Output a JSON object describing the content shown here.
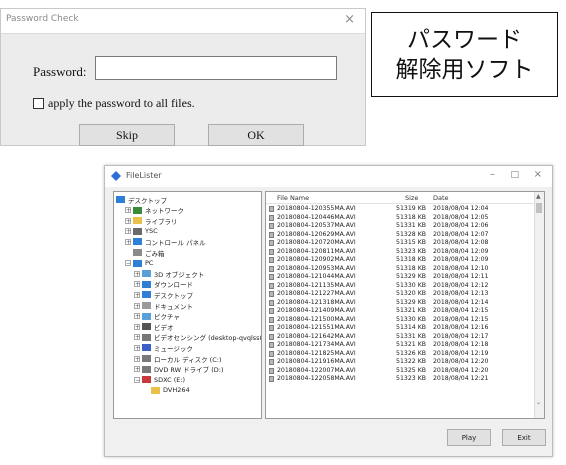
{
  "password_dialog": {
    "title": "Password Check",
    "close_glyph": "×",
    "password_label": "Password:",
    "password_value": "",
    "apply_all_label": "apply the password to all files.",
    "apply_all_checked": false,
    "skip_label": "Skip",
    "ok_label": "OK"
  },
  "caption": {
    "line1": "パスワード",
    "line2": "解除用ソフト"
  },
  "filelister": {
    "title": "FileLister",
    "window_controls": {
      "minimize": "–",
      "maximize": "□",
      "close": "×"
    },
    "tree": [
      {
        "label": "デスクトップ",
        "icon": "desktop-icon",
        "expander": "",
        "depth": 0
      },
      {
        "label": "ネットワーク",
        "icon": "network-icon",
        "expander": "+",
        "depth": 1
      },
      {
        "label": "ライブラリ",
        "icon": "library-icon",
        "expander": "+",
        "depth": 1
      },
      {
        "label": "YSC",
        "icon": "user-icon",
        "expander": "+",
        "depth": 1
      },
      {
        "label": "コントロール パネル",
        "icon": "control-panel-icon",
        "expander": "+",
        "depth": 1
      },
      {
        "label": "ごみ箱",
        "icon": "recycle-bin-icon",
        "expander": "",
        "depth": 1
      },
      {
        "label": "PC",
        "icon": "pc-icon",
        "expander": "−",
        "depth": 1
      },
      {
        "label": "3D オブジェクト",
        "icon": "folder-3d-icon",
        "expander": "+",
        "depth": 2
      },
      {
        "label": "ダウンロード",
        "icon": "download-icon",
        "expander": "+",
        "depth": 2
      },
      {
        "label": "デスクトップ",
        "icon": "desktop-icon",
        "expander": "+",
        "depth": 2
      },
      {
        "label": "ドキュメント",
        "icon": "documents-icon",
        "expander": "+",
        "depth": 2
      },
      {
        "label": "ピクチャ",
        "icon": "pictures-icon",
        "expander": "+",
        "depth": 2
      },
      {
        "label": "ビデオ",
        "icon": "video-icon",
        "expander": "+",
        "depth": 2
      },
      {
        "label": "ビデオセンシング (desktop-qvqlss8q)",
        "icon": "network-drive-icon",
        "expander": "+",
        "depth": 2
      },
      {
        "label": "ミュージック",
        "icon": "music-icon",
        "expander": "+",
        "depth": 2
      },
      {
        "label": "ローカル ディスク (C:)",
        "icon": "disk-icon",
        "expander": "+",
        "depth": 2
      },
      {
        "label": "DVD RW ドライブ (D:)",
        "icon": "dvd-drive-icon",
        "expander": "+",
        "depth": 2
      },
      {
        "label": "SDXC (E:)",
        "icon": "sd-card-icon",
        "expander": "−",
        "depth": 2
      },
      {
        "label": "DVH264",
        "icon": "folder-icon",
        "expander": "",
        "depth": 3
      }
    ],
    "columns": {
      "name": "File Name",
      "size": "Size",
      "date": "Date"
    },
    "files": [
      {
        "name": "20180804-120355MA.AVI",
        "size": "51319 KB",
        "date": "2018/08/04 12:04"
      },
      {
        "name": "20180804-120446MA.AVI",
        "size": "51318 KB",
        "date": "2018/08/04 12:05"
      },
      {
        "name": "20180804-120537MA.AVI",
        "size": "51331 KB",
        "date": "2018/08/04 12:06"
      },
      {
        "name": "20180804-120629MA.AVI",
        "size": "51328 KB",
        "date": "2018/08/04 12:07"
      },
      {
        "name": "20180804-120720MA.AVI",
        "size": "51315 KB",
        "date": "2018/08/04 12:08"
      },
      {
        "name": "20180804-120811MA.AVI",
        "size": "51323 KB",
        "date": "2018/08/04 12:09"
      },
      {
        "name": "20180804-120902MA.AVI",
        "size": "51318 KB",
        "date": "2018/08/04 12:09"
      },
      {
        "name": "20180804-120953MA.AVI",
        "size": "51318 KB",
        "date": "2018/08/04 12:10"
      },
      {
        "name": "20180804-121044MA.AVI",
        "size": "51329 KB",
        "date": "2018/08/04 12:11"
      },
      {
        "name": "20180804-121135MA.AVI",
        "size": "51330 KB",
        "date": "2018/08/04 12:12"
      },
      {
        "name": "20180804-121227MA.AVI",
        "size": "51320 KB",
        "date": "2018/08/04 12:13"
      },
      {
        "name": "20180804-121318MA.AVI",
        "size": "51329 KB",
        "date": "2018/08/04 12:14"
      },
      {
        "name": "20180804-121409MA.AVI",
        "size": "51321 KB",
        "date": "2018/08/04 12:15"
      },
      {
        "name": "20180804-121500MA.AVI",
        "size": "51330 KB",
        "date": "2018/08/04 12:15"
      },
      {
        "name": "20180804-121551MA.AVI",
        "size": "51314 KB",
        "date": "2018/08/04 12:16"
      },
      {
        "name": "20180804-121642MA.AVI",
        "size": "51331 KB",
        "date": "2018/08/04 12:17"
      },
      {
        "name": "20180804-121734MA.AVI",
        "size": "51321 KB",
        "date": "2018/08/04 12:18"
      },
      {
        "name": "20180804-121825MA.AVI",
        "size": "51326 KB",
        "date": "2018/08/04 12:19"
      },
      {
        "name": "20180804-121916MA.AVI",
        "size": "51322 KB",
        "date": "2018/08/04 12:20"
      },
      {
        "name": "20180804-122007MA.AVI",
        "size": "51325 KB",
        "date": "2018/08/04 12:20"
      },
      {
        "name": "20180804-122058MA.AVI",
        "size": "51323 KB",
        "date": "2018/08/04 12:21"
      }
    ],
    "play_label": "Play",
    "exit_label": "Exit",
    "scroll": {
      "up": "▲",
      "down": "⌄"
    }
  },
  "colors": {
    "folder": "#e8c04a",
    "desktop": "#2f7fd6",
    "network": "#3a8a3a",
    "disk": "#7a7a7a",
    "music": "#3a5fc8",
    "sd_card": "#c83a3a",
    "app_icon": "#2f6fd6"
  }
}
